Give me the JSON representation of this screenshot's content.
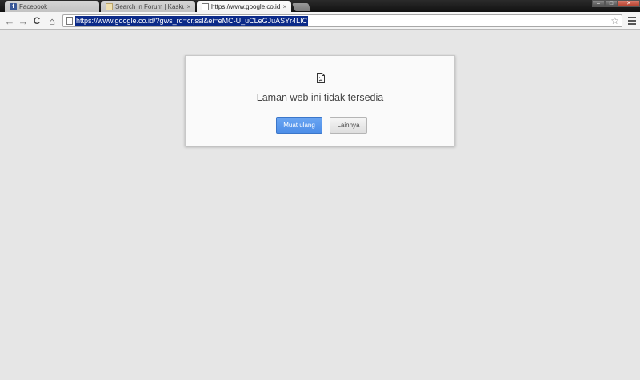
{
  "tabs": [
    {
      "title": "Facebook",
      "icon": "facebook-icon"
    },
    {
      "title": "Search in Forum | Kaskus - T",
      "icon": "kaskus-icon"
    },
    {
      "title": "https://www.google.co.id/?g",
      "icon": "page-icon",
      "active": true
    }
  ],
  "tab_close_glyph": "×",
  "window_controls": {
    "minimize": "–",
    "maximize": "□",
    "close": "✕"
  },
  "toolbar": {
    "back": "←",
    "forward": "→",
    "reload": "C",
    "home": "⌂",
    "url": "https://www.google.co.id/?gws_rd=cr,ssl&ei=eMC-U_uCLeGJuASYr4LIC",
    "star": "☆"
  },
  "error": {
    "title": "Laman web ini tidak tersedia",
    "reload_label": "Muat ulang",
    "more_label": "Lainnya"
  },
  "colors": {
    "page_background": "#e6e6e6",
    "reload_button": "#4d8ee8",
    "url_selection": "#0b2a88"
  }
}
